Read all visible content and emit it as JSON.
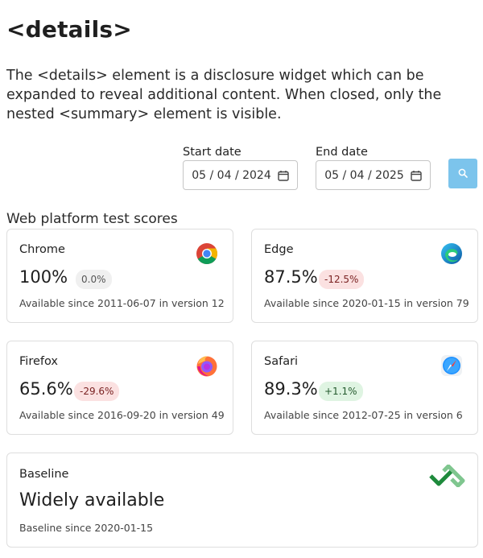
{
  "page": {
    "title": "<details>",
    "description": "The <details> element is a disclosure widget which can be expanded to reveal additional content. When closed, only the nested <summary> element is visible."
  },
  "filters": {
    "start_label": "Start date",
    "start_value": "05 / 04 / 2024",
    "end_label": "End date",
    "end_value": "05 / 04 / 2025",
    "search_icon": "search-icon",
    "accent_color": "#7cc4ec"
  },
  "scores": {
    "heading": "Web platform test scores",
    "browsers": [
      {
        "name": "Chrome",
        "score": "100%",
        "delta": "0.0%",
        "trend": "neutral",
        "availability": "Available since 2011-06-07 in version 12",
        "icon": "chrome-icon"
      },
      {
        "name": "Edge",
        "score": "87.5%",
        "delta": "-12.5%",
        "trend": "negative",
        "availability": "Available since 2020-01-15 in version 79",
        "icon": "edge-icon"
      },
      {
        "name": "Firefox",
        "score": "65.6%",
        "delta": "-29.6%",
        "trend": "negative",
        "availability": "Available since 2016-09-20 in version 49",
        "icon": "firefox-icon"
      },
      {
        "name": "Safari",
        "score": "89.3%",
        "delta": "+1.1%",
        "trend": "positive",
        "availability": "Available since 2012-07-25 in version 6",
        "icon": "safari-icon"
      }
    ]
  },
  "baseline": {
    "title": "Baseline",
    "status": "Widely available",
    "since": "Baseline since 2020-01-15",
    "icon": "baseline-check-icon",
    "color": "#1e8a3c"
  }
}
